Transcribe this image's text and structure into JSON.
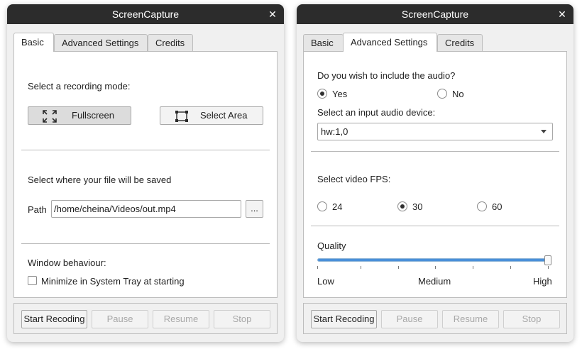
{
  "left_window": {
    "title": "ScreenCapture",
    "close_glyph": "✕",
    "tabs": [
      "Basic",
      "Advanced Settings",
      "Credits"
    ],
    "active_tab": "Basic",
    "recording_mode_label": "Select a recording mode:",
    "fullscreen_label": "Fullscreen",
    "select_area_label": "Select Area",
    "save_location_label": "Select where your file will be saved",
    "path_label": "Path",
    "path_value": "/home/cheina/Videos/out.mp4",
    "browse_label": "...",
    "window_behaviour_label": "Window behaviour:",
    "minimize_tray_label": "Minimize in System Tray at starting",
    "minimize_tray_checked": false,
    "bottom_buttons": {
      "start": "Start Recoding",
      "pause": "Pause",
      "resume": "Resume",
      "stop": "Stop"
    }
  },
  "right_window": {
    "title": "ScreenCapture",
    "close_glyph": "✕",
    "tabs": [
      "Basic",
      "Advanced Settings",
      "Credits"
    ],
    "active_tab": "Advanced Settings",
    "audio_question": "Do you wish to include the audio?",
    "audio_yes": "Yes",
    "audio_no": "No",
    "audio_selected": "Yes",
    "audio_device_label": "Select an input audio device:",
    "audio_device_value": "hw:1,0",
    "fps_label": "Select video FPS:",
    "fps_options": [
      "24",
      "30",
      "60"
    ],
    "fps_selected": "30",
    "quality_label": "Quality",
    "quality_low": "Low",
    "quality_medium": "Medium",
    "quality_high": "High",
    "quality_value_fraction": 1.0,
    "bottom_buttons": {
      "start": "Start Recoding",
      "pause": "Pause",
      "resume": "Resume",
      "stop": "Stop"
    }
  },
  "icons": {
    "close": "close-icon",
    "fullscreen": "fullscreen-icon",
    "select_area": "select-area-icon",
    "dropdown": "chevron-down-icon"
  },
  "colors": {
    "titlebar": "#2c2c2c",
    "slider_fill": "#4a90d9",
    "disabled_text": "#a8a8a8"
  }
}
